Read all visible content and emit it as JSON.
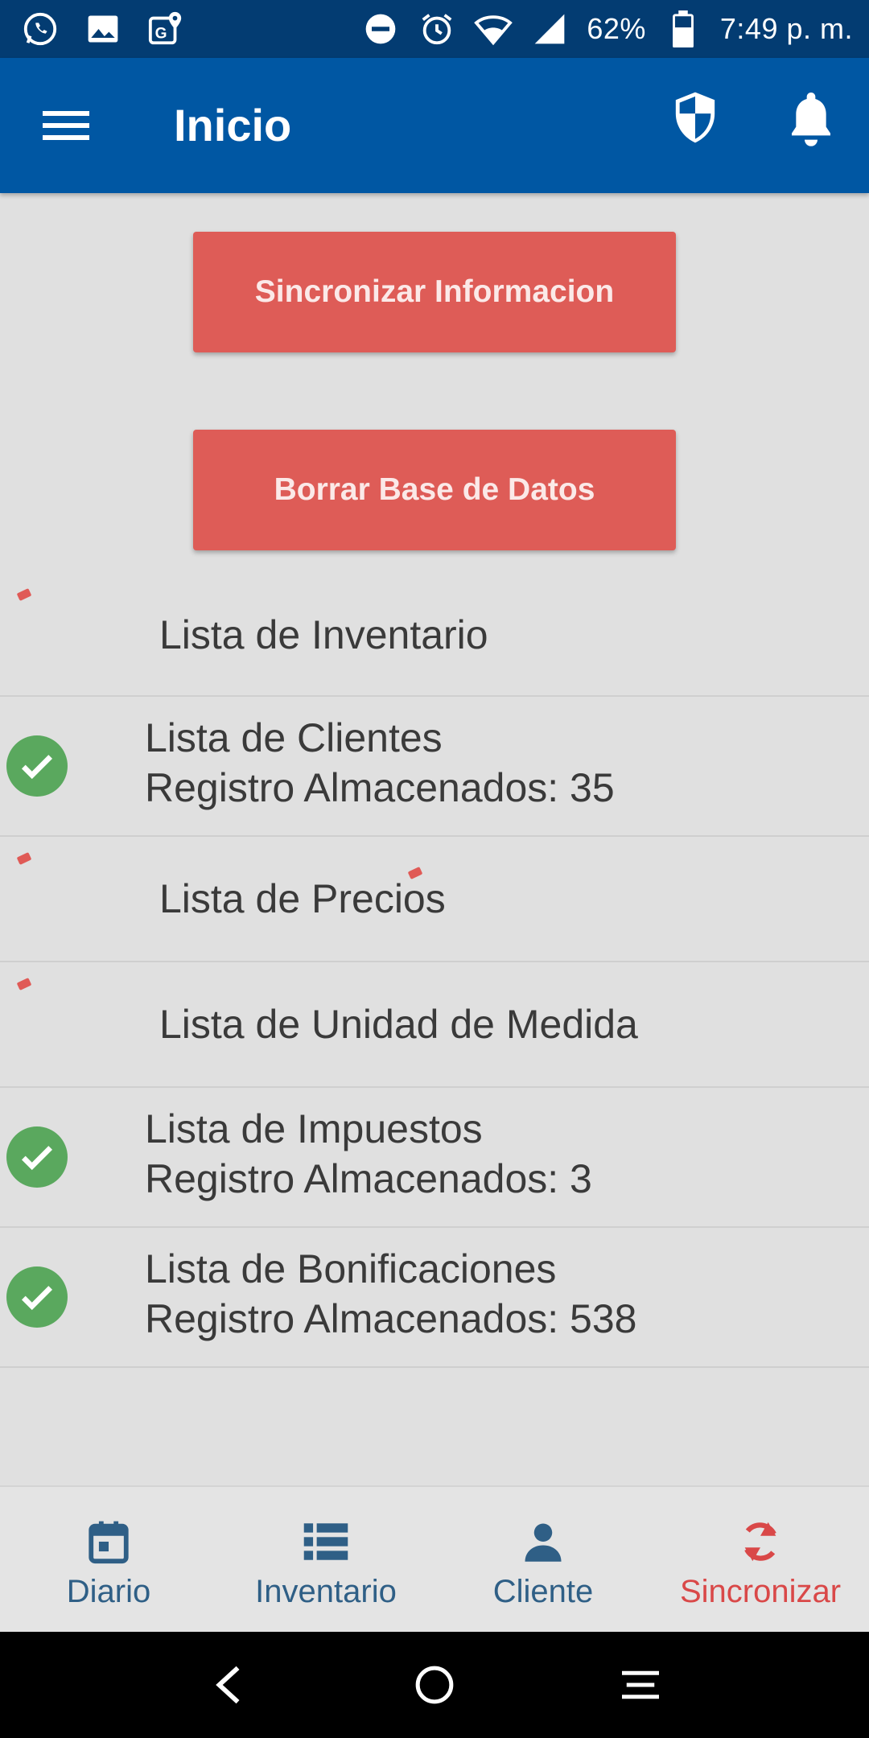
{
  "status_bar": {
    "battery": "62%",
    "time": "7:49 p. m.",
    "icons": [
      "whatsapp-icon",
      "image-icon",
      "maps-icon",
      "dnd-icon",
      "alarm-icon",
      "wifi-icon",
      "signal-icon",
      "battery-icon"
    ]
  },
  "app_bar": {
    "title": "Inicio",
    "icons": [
      "menu-icon",
      "shield-icon",
      "bell-icon"
    ]
  },
  "actions": {
    "sync_label": "Sincronizar Informacion",
    "clear_label": "Borrar Base de Datos"
  },
  "sync_list": [
    {
      "name": "Lista de Inventario",
      "status": "loading"
    },
    {
      "name": "Lista de Clientes",
      "count_text": "Registro Almacenados: 35",
      "status": "done"
    },
    {
      "name": "Lista de Precios",
      "status": "loading"
    },
    {
      "name": "Lista de Unidad de Medida",
      "status": "loading"
    },
    {
      "name": "Lista de Impuestos",
      "count_text": "Registro Almacenados: 3",
      "status": "done"
    },
    {
      "name": "Lista de Bonificaciones",
      "count_text": "Registro Almacenados: 538",
      "status": "done"
    }
  ],
  "bottom_nav": {
    "items": [
      {
        "label": "Diario",
        "icon": "calendar-icon"
      },
      {
        "label": "Inventario",
        "icon": "list-icon"
      },
      {
        "label": "Cliente",
        "icon": "person-icon"
      },
      {
        "label": "Sincronizar",
        "icon": "sync-icon",
        "active": true
      }
    ]
  },
  "colors": {
    "status_bar": "#033c72",
    "app_bar": "#0057a3",
    "button": "#de5c57",
    "check": "#5aa85e",
    "nav_inactive": "#2f5f86",
    "nav_active": "#d94848"
  }
}
